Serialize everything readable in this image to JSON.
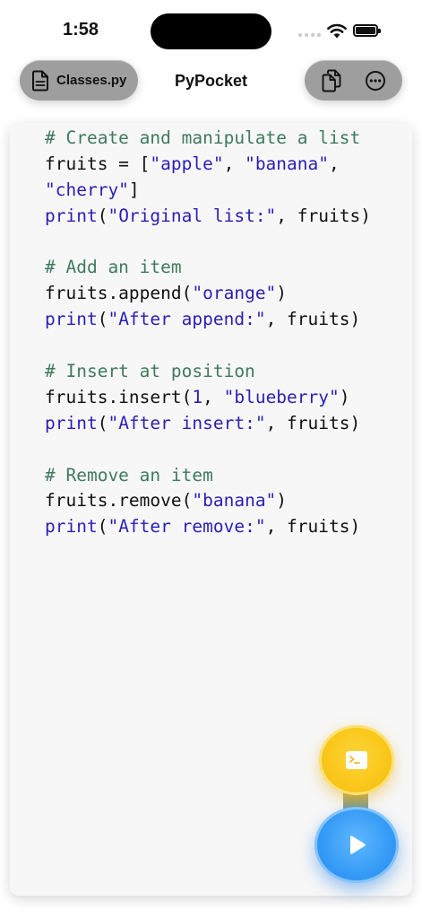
{
  "status_bar": {
    "time": "1:58"
  },
  "nav": {
    "file_tab_label": "Classes.py",
    "title": "PyPocket",
    "file_icon": "document-icon",
    "copy_icon": "copy-files-icon",
    "more_icon": "ellipsis-circle-icon"
  },
  "code_lines": [
    [
      {
        "t": "# Create and manipulate a list",
        "k": "comment"
      }
    ],
    [
      {
        "t": "fruits = [",
        "k": "plain"
      },
      {
        "t": "\"apple\"",
        "k": "string"
      },
      {
        "t": ", ",
        "k": "plain"
      },
      {
        "t": "\"banana\"",
        "k": "string"
      },
      {
        "t": ",",
        "k": "plain"
      }
    ],
    [
      {
        "t": "\"cherry\"",
        "k": "string"
      },
      {
        "t": "]",
        "k": "plain"
      }
    ],
    [
      {
        "t": "print",
        "k": "func"
      },
      {
        "t": "(",
        "k": "plain"
      },
      {
        "t": "\"Original list:\"",
        "k": "string"
      },
      {
        "t": ", fruits)",
        "k": "plain"
      }
    ],
    [],
    [
      {
        "t": "# Add an item",
        "k": "comment"
      }
    ],
    [
      {
        "t": "fruits.append(",
        "k": "plain"
      },
      {
        "t": "\"orange\"",
        "k": "string"
      },
      {
        "t": ")",
        "k": "plain"
      }
    ],
    [
      {
        "t": "print",
        "k": "func"
      },
      {
        "t": "(",
        "k": "plain"
      },
      {
        "t": "\"After append:\"",
        "k": "string"
      },
      {
        "t": ", fruits)",
        "k": "plain"
      }
    ],
    [],
    [
      {
        "t": "# Insert at position",
        "k": "comment"
      }
    ],
    [
      {
        "t": "fruits.insert(",
        "k": "plain"
      },
      {
        "t": "1",
        "k": "string"
      },
      {
        "t": ", ",
        "k": "plain"
      },
      {
        "t": "\"blueberry\"",
        "k": "string"
      },
      {
        "t": ")",
        "k": "plain"
      }
    ],
    [
      {
        "t": "print",
        "k": "func"
      },
      {
        "t": "(",
        "k": "plain"
      },
      {
        "t": "\"After insert:\"",
        "k": "string"
      },
      {
        "t": ", fruits)",
        "k": "plain"
      }
    ],
    [],
    [
      {
        "t": "# Remove an item",
        "k": "comment"
      }
    ],
    [
      {
        "t": "fruits.remove(",
        "k": "plain"
      },
      {
        "t": "\"banana\"",
        "k": "string"
      },
      {
        "t": ")",
        "k": "plain"
      }
    ],
    [
      {
        "t": "print",
        "k": "func"
      },
      {
        "t": "(",
        "k": "plain"
      },
      {
        "t": "\"After remove:\"",
        "k": "string"
      },
      {
        "t": ", fruits)",
        "k": "plain"
      }
    ]
  ],
  "syntax_colors": {
    "comment": "#3f7a5e",
    "string": "#2a1fb5",
    "plain": "#111111"
  },
  "fabs": {
    "terminal_icon": "terminal-icon",
    "terminal_color": "#f9c719",
    "run_icon": "play-icon",
    "run_color": "#3399f5"
  }
}
